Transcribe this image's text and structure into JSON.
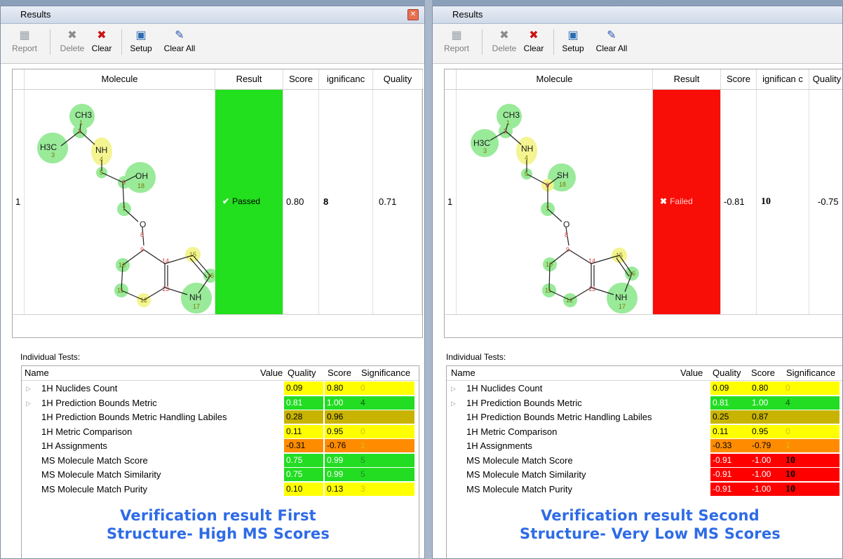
{
  "left": {
    "title": "Results",
    "toolbar": {
      "report": "Report",
      "delete": "Delete",
      "clear": "Clear",
      "setup": "Setup",
      "clear_all": "Clear All"
    },
    "columns": {
      "molecule": "Molecule",
      "result": "Result",
      "score": "Score",
      "significance": "ignificanc",
      "quality": "Quality"
    },
    "row": {
      "index": "1",
      "result": "Passed",
      "score": "0.80",
      "significance": "8",
      "quality": "0.71"
    },
    "molecule_labels": {
      "ch3": "CH3",
      "h3c": "H3C",
      "nh": "NH",
      "oh": "OH",
      "o": "O",
      "nh17": "NH",
      "n1": "1",
      "n2": "2",
      "n3": "3",
      "n4": "4",
      "n5": "5",
      "n6": "6",
      "n7": "7",
      "n8": "8",
      "n9": "9",
      "n10": "10",
      "n11": "11",
      "n12": "12",
      "n13": "13",
      "n14": "14",
      "n15": "15",
      "n16": "16",
      "n17": "17",
      "n18": "18"
    },
    "individual_tests_label": "Individual Tests:",
    "tests_columns": {
      "name": "Name",
      "value": "Value",
      "quality": "Quality",
      "score": "Score",
      "significance": "Significance"
    },
    "tests": [
      {
        "name": "1H Nuclides Count",
        "quality": "0.09",
        "score": "0.80",
        "significance": "0",
        "color": "#ffff00"
      },
      {
        "name": "1H Prediction Bounds Metric",
        "quality": "0.81",
        "score": "1.00",
        "significance": "4",
        "color": "#22dd22"
      },
      {
        "name": "1H Prediction Bounds Metric Handling Labiles",
        "quality": "0.28",
        "score": "0.96",
        "significance": "",
        "color": "#c8b400"
      },
      {
        "name": "1H Metric Comparison",
        "quality": "0.11",
        "score": "0.95",
        "significance": "0",
        "color": "#ffff00"
      },
      {
        "name": "1H Assignments",
        "quality": "-0.31",
        "score": "-0.76",
        "significance": "1",
        "color": "#ff8c00"
      },
      {
        "name": "MS Molecule Match Score",
        "quality": "0.75",
        "score": "0.99",
        "significance": "5",
        "color": "#22dd22"
      },
      {
        "name": "MS Molecule Match Similarity",
        "quality": "0.75",
        "score": "0.99",
        "significance": "5",
        "color": "#22dd22"
      },
      {
        "name": "MS Molecule Match Purity",
        "quality": "0.10",
        "score": "0.13",
        "significance": "3",
        "color": "#ffff00"
      }
    ],
    "caption_line1": "Verification result First",
    "caption_line2": "Structure- High MS Scores"
  },
  "right": {
    "title": "Results",
    "toolbar": {
      "report": "Report",
      "delete": "Delete",
      "clear": "Clear",
      "setup": "Setup",
      "clear_all": "Clear All"
    },
    "columns": {
      "molecule": "Molecule",
      "result": "Result",
      "score": "Score",
      "significance": "ignifican c",
      "quality": "Quality"
    },
    "row": {
      "index": "1",
      "result": "Failed",
      "score": "-0.81",
      "significance": "10",
      "quality": "-0.75"
    },
    "molecule_labels": {
      "ch3": "CH3",
      "h3c": "H3C",
      "nh": "NH",
      "sh": "SH",
      "o": "O",
      "nh17": "NH",
      "n1": "1",
      "n2": "2",
      "n3": "3",
      "n4": "4",
      "n5": "5",
      "n6": "6",
      "n7": "7",
      "n8": "8",
      "n9": "9",
      "n10": "10",
      "n11": "11",
      "n12": "12",
      "n13": "13",
      "n14": "14",
      "n15": "15",
      "n16": "16",
      "n17": "17",
      "n18": "18"
    },
    "individual_tests_label": "Individual Tests:",
    "tests_columns": {
      "name": "Name",
      "value": "Value",
      "quality": "Quality",
      "score": "Score",
      "significance": "Significance"
    },
    "tests": [
      {
        "name": "1H Nuclides Count",
        "quality": "0.09",
        "score": "0.80",
        "significance": "0",
        "color": "#ffff00"
      },
      {
        "name": "1H Prediction Bounds Metric",
        "quality": "0.81",
        "score": "1.00",
        "significance": "4",
        "color": "#22dd22"
      },
      {
        "name": "1H Prediction Bounds Metric Handling Labiles",
        "quality": "0.25",
        "score": "0.87",
        "significance": "",
        "color": "#c8b400"
      },
      {
        "name": "1H Metric Comparison",
        "quality": "0.11",
        "score": "0.95",
        "significance": "0",
        "color": "#ffff00"
      },
      {
        "name": "1H Assignments",
        "quality": "-0.33",
        "score": "-0.79",
        "significance": "1",
        "color": "#ff8c00"
      },
      {
        "name": "MS Molecule Match Score",
        "quality": "-0.91",
        "score": "-1.00",
        "significance": "10",
        "color": "#ff0000"
      },
      {
        "name": "MS Molecule Match Similarity",
        "quality": "-0.91",
        "score": "-1.00",
        "significance": "10",
        "color": "#ff0000"
      },
      {
        "name": "MS Molecule Match Purity",
        "quality": "-0.91",
        "score": "-1.00",
        "significance": "10",
        "color": "#ff0000"
      }
    ],
    "caption_line1": "Verification result Second",
    "caption_line2": "Structure- Very Low MS Scores"
  }
}
